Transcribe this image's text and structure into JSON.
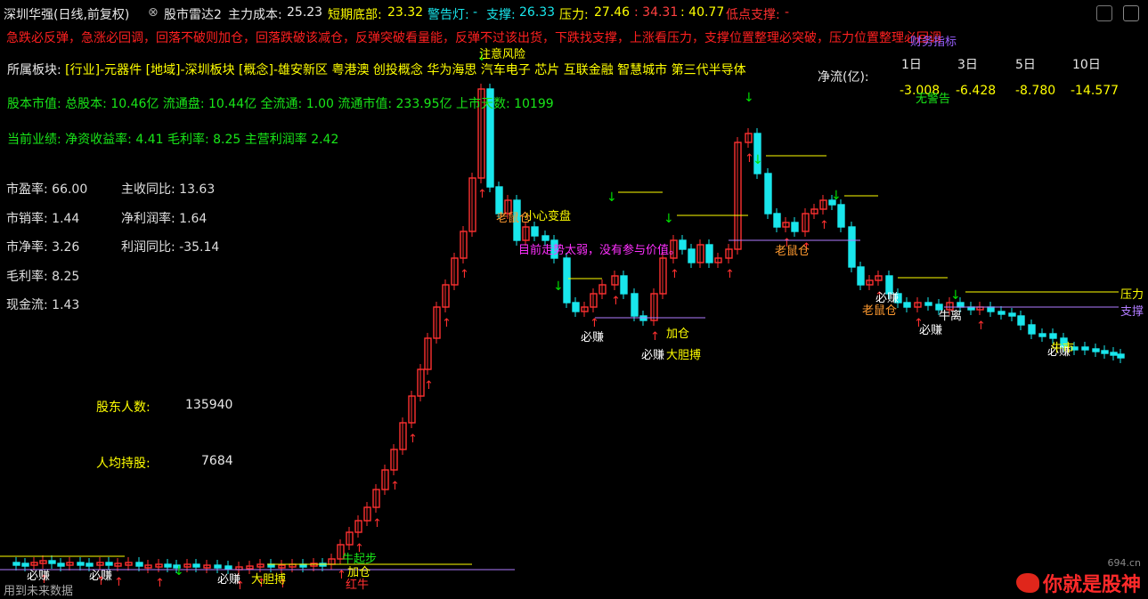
{
  "titlebar": {
    "stock": "深圳华强(日线,前复权)",
    "indicator": "股市雷达2",
    "main_cost_label": "主力成本:",
    "main_cost": "25.23",
    "short_bottom_label": "短期底部:",
    "short_bottom": "23.32",
    "warning_label": "警告灯:",
    "warning_value": "-",
    "support_label": "支撑:",
    "support": "26.33",
    "pressure_label": "压力:",
    "pressure": "27.46",
    "v1": ": 34.31",
    "v2": ": 40.77",
    "low_support_label": "低点支撑:",
    "low_support_value": "-"
  },
  "rule_text": "急跌必反弹，急涨必回调，回落不破则加仓，回落跌破该减仓，反弹突破看量能，反弹不过该出货，下跌找支撑，上涨看压力，支撑位置整理必突破，压力位置整理必回调",
  "overlay_top": "财务指标",
  "sector": {
    "label": "所属板块:",
    "value": "[行业]-元器件 [地域]-深圳板块 [概念]-雄安新区 粤港澳 创投概念 华为海思 汽车电子 芯片 互联金融 智慧城市 第三代半导体"
  },
  "capital": {
    "text": "股本市值: 总股本: 10.46亿 流通盘: 10.44亿 全流通: 1.00 流通市值: 233.95亿 上市天数: 10199"
  },
  "performance": {
    "text": "当前业绩: 净资收益率: 4.41 毛利率: 8.25 主营利润率 2.42"
  },
  "netflow": {
    "label": "净流(亿):",
    "headers": [
      "1日",
      "3日",
      "5日",
      "10日"
    ],
    "values": [
      "-3.008",
      "-6.428",
      "-8.780",
      "-14.577"
    ],
    "note": "无警告"
  },
  "financials": [
    {
      "label": "市盈率:",
      "value": "66.00"
    },
    {
      "label": "市销率:",
      "value": "1.44"
    },
    {
      "label": "市净率:",
      "value": "3.26"
    },
    {
      "label": "毛利率:",
      "value": "8.25"
    },
    {
      "label": "现金流:",
      "value": "1.43"
    }
  ],
  "financials2": [
    {
      "label": "主收同比:",
      "value": "13.63"
    },
    {
      "label": "净利润率:",
      "value": "1.64"
    },
    {
      "label": "利润同比:",
      "value": "-35.14"
    }
  ],
  "holders": {
    "count_label": "股东人数:",
    "count": "135940",
    "avg_label": "人均持股:",
    "avg": "7684"
  },
  "signals": {
    "attention": "注意风险",
    "careful": "小心变盘",
    "weak": "目前走势太弱，没有参与价值。",
    "must_earn": "必赚",
    "old_rat": "老鼠仓",
    "bold": "大胆搏",
    "add": "加仓",
    "start": "牛起步",
    "red": "红牛",
    "pressure": "压力",
    "support": "支撑",
    "jump": "牛离",
    "hold": "牛市"
  },
  "bottom_note": "用到未来数据",
  "watermark": {
    "site": "694.cn",
    "slogan": "你就是股神"
  },
  "colors": {
    "up": "#ff3030",
    "down": "#19e6ec",
    "yellow": "#ffff00",
    "purple": "#b07cff",
    "green": "#00e000"
  }
}
